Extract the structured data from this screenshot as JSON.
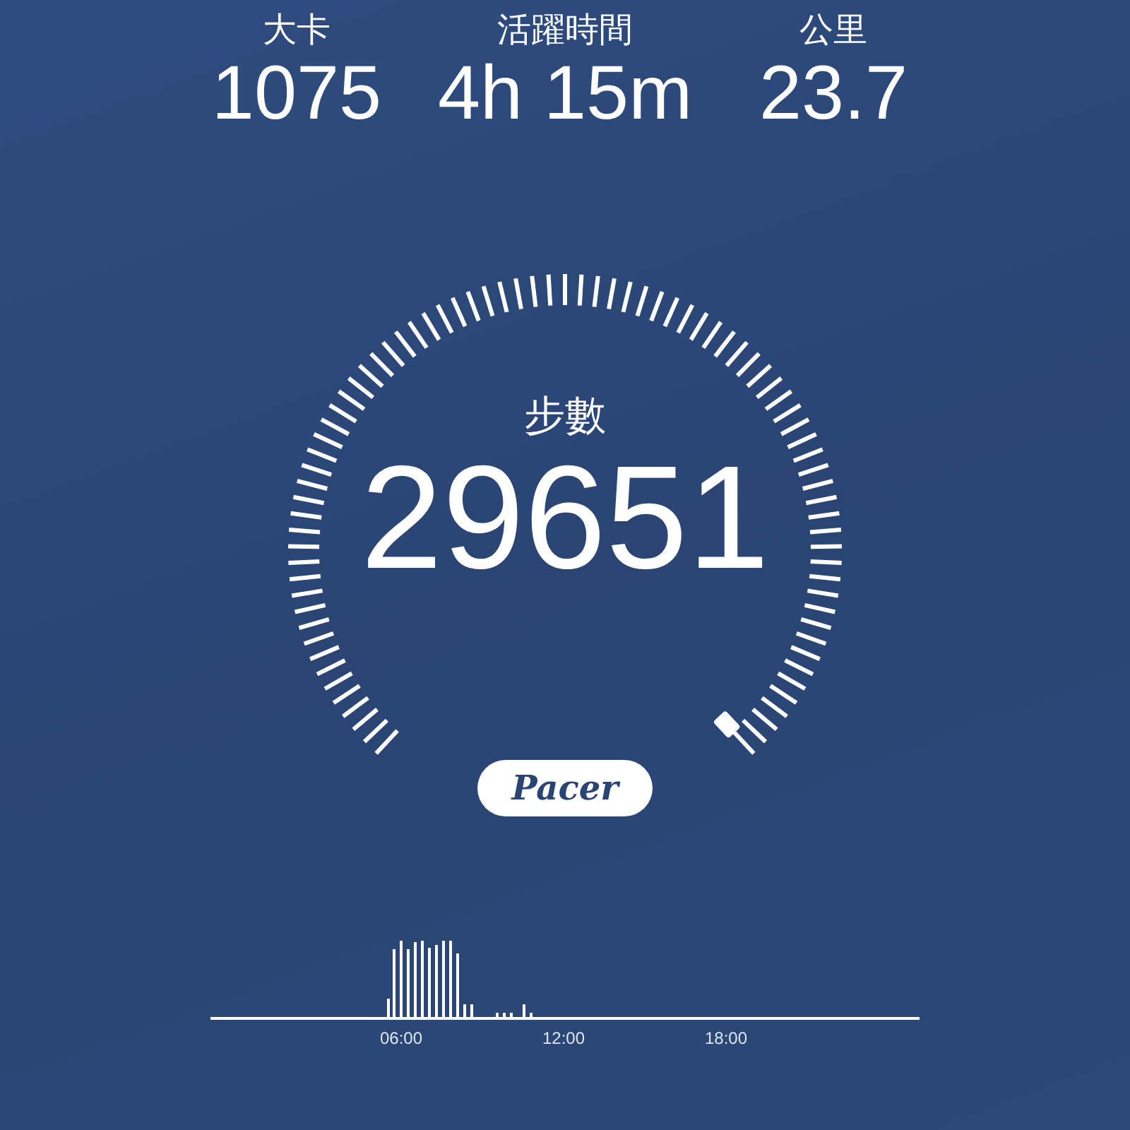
{
  "stats": [
    {
      "label": "大卡",
      "value": "1075"
    },
    {
      "label": "活躍時間",
      "value": "4h 15m"
    },
    {
      "label": "公里",
      "value": "23.7"
    }
  ],
  "gauge": {
    "label": "步數",
    "value": "29651"
  },
  "logo": {
    "text": "Pacer"
  },
  "activity_chart": {
    "x_labels": [
      "06:00",
      "12:00",
      "18:00"
    ]
  }
}
